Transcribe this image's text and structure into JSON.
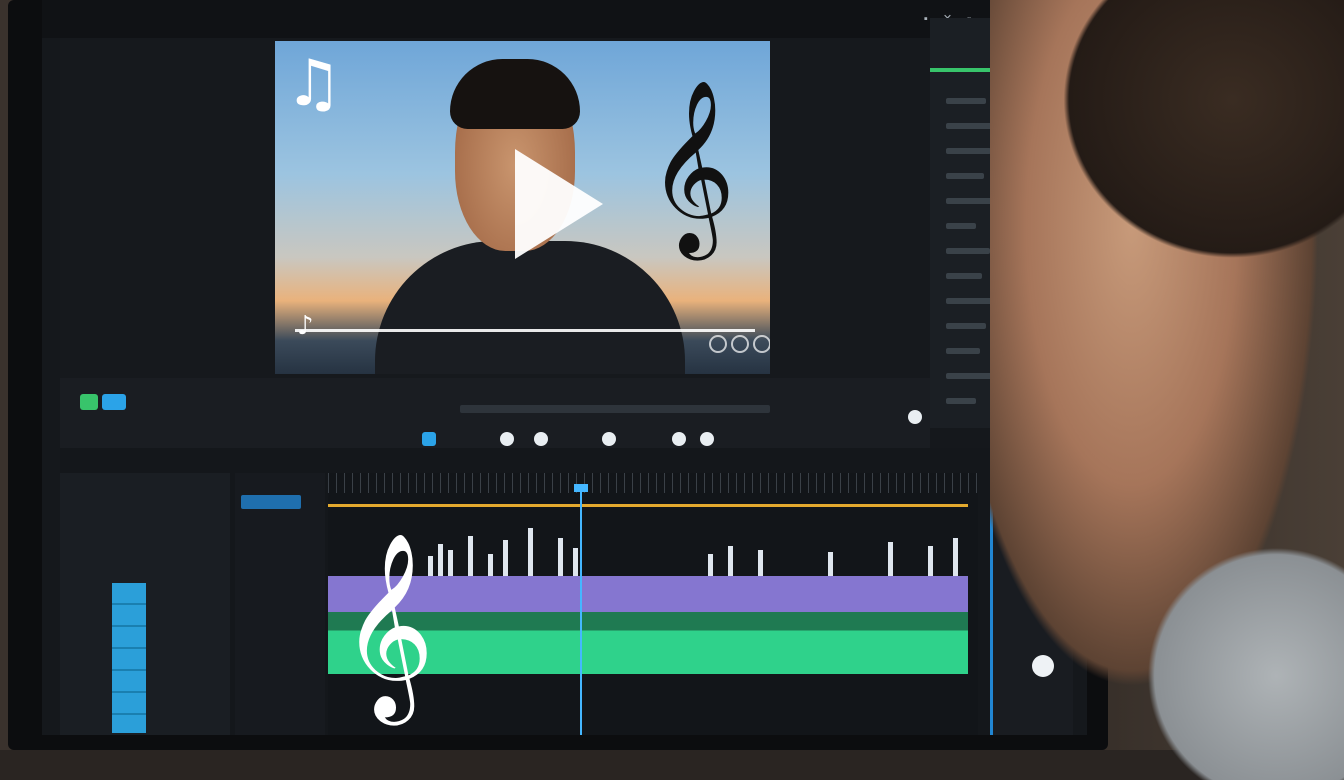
{
  "window": {
    "title": ""
  },
  "preview": {
    "timecode": "",
    "icons": [
      "music-note-icon",
      "treble-clef-icon",
      "play-icon"
    ]
  },
  "transport": {
    "center_label": "",
    "orange_labels": [
      "",
      ""
    ]
  },
  "timeline": {
    "tracks": [
      "",
      "",
      "",
      ""
    ],
    "clip_label": ""
  },
  "colors": {
    "accent_blue": "#2186d3",
    "accent_green": "#38c46b",
    "clip_purple": "#8f7fe0",
    "clip_green": "#2fd28b",
    "timeline_yellow": "#e3a92e",
    "playhead": "#45b7ff"
  }
}
